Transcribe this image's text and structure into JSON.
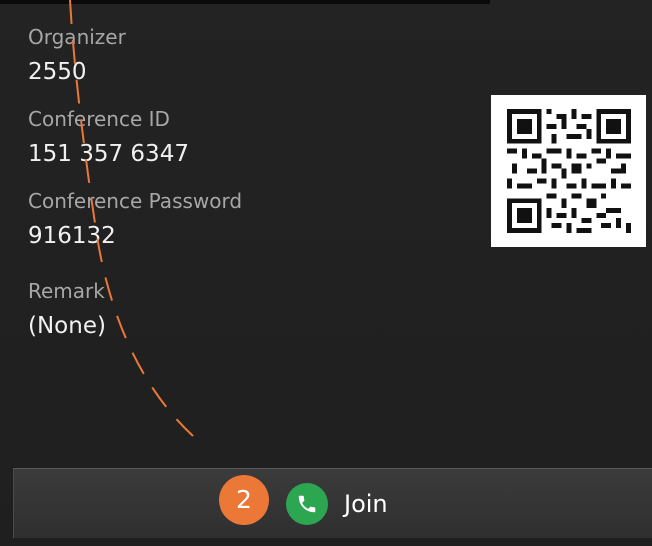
{
  "details": {
    "organizer_label": "Organizer",
    "organizer_value": "2550",
    "conference_id_label": "Conference ID",
    "conference_id_value": "151 357 6347",
    "password_label": "Conference Password",
    "password_value": "916132",
    "remark_label": "Remark",
    "remark_value": "(None)"
  },
  "actions": {
    "step_number": "2",
    "join_label": "Join"
  },
  "icons": {
    "qr": "qr-code-icon",
    "phone": "phone-icon"
  },
  "colors": {
    "background": "#202020",
    "annotation": "#ec7838",
    "join_icon": "#2da651"
  }
}
